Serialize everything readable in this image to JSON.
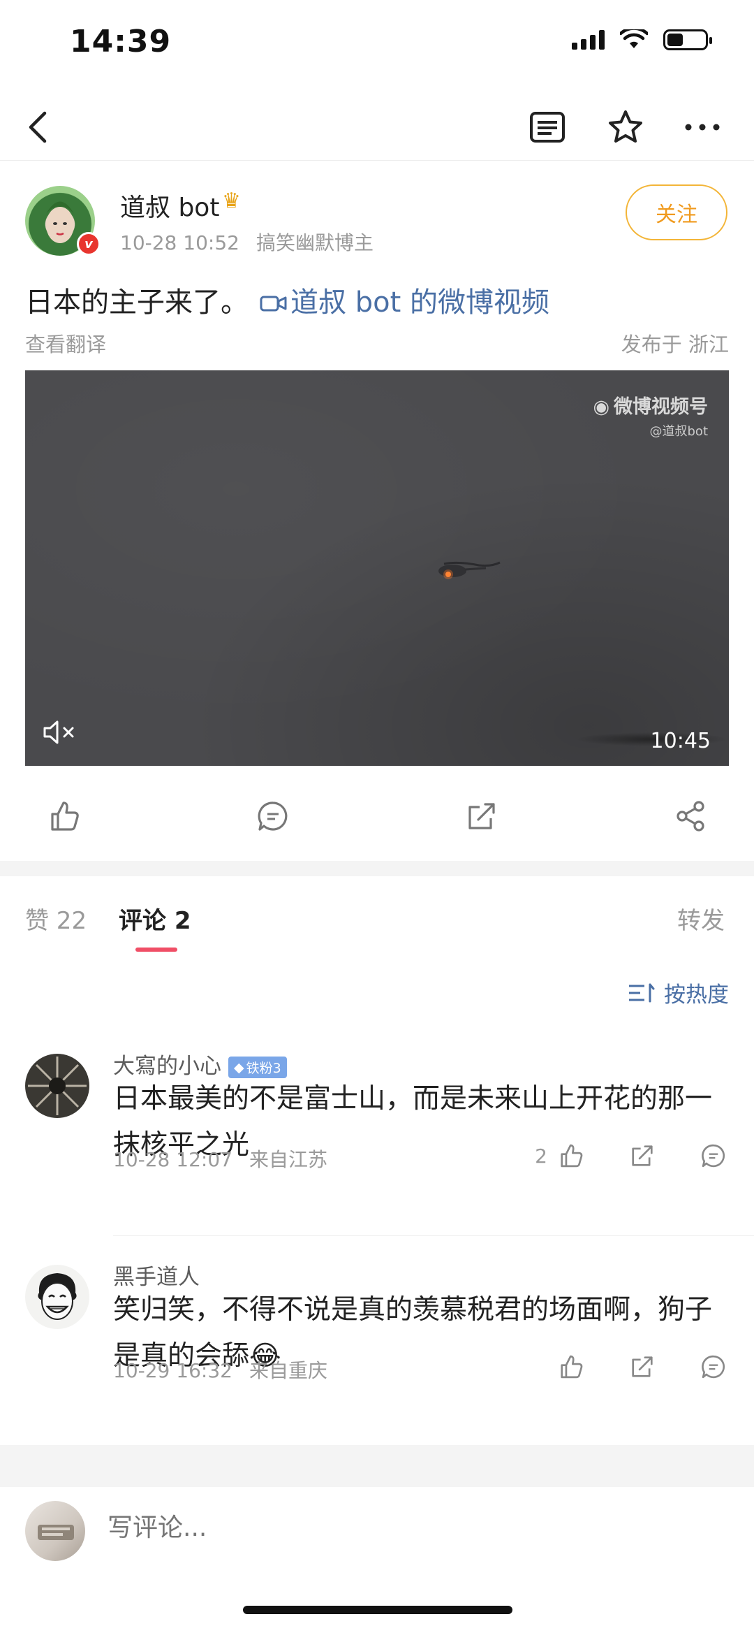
{
  "status_bar": {
    "time": "14:39"
  },
  "post": {
    "author": "道叔 bot",
    "date": "10-28 10:52",
    "tag": "搞笑幽默博主",
    "follow_label": "关注",
    "text": "日本的主子来了。",
    "video_link": "道叔 bot 的微博视频",
    "translate_label": "查看翻译",
    "location": "发布于 浙江",
    "video": {
      "watermark_title": "微博视频号",
      "watermark_handle": "@道叔bot",
      "duration": "10:45"
    }
  },
  "tabs": {
    "likes": "赞 22",
    "comments": "评论 2",
    "repost": "转发"
  },
  "sort_label": "按热度",
  "comments": [
    {
      "name": "大寫的小心",
      "badge": "铁粉3",
      "text": "日本最美的不是富士山，而是未来山上开花的那一抹核平之光",
      "date": "10-28 12:07",
      "from": "来自江苏",
      "likes": "2"
    },
    {
      "name": "黑手道人",
      "text": "笑归笑，不得不说是真的羡慕税君的场面啊，狗子是真的会舔😂",
      "date": "10-29 16:32",
      "from": "来自重庆"
    }
  ],
  "compose": {
    "placeholder": "写评论..."
  }
}
